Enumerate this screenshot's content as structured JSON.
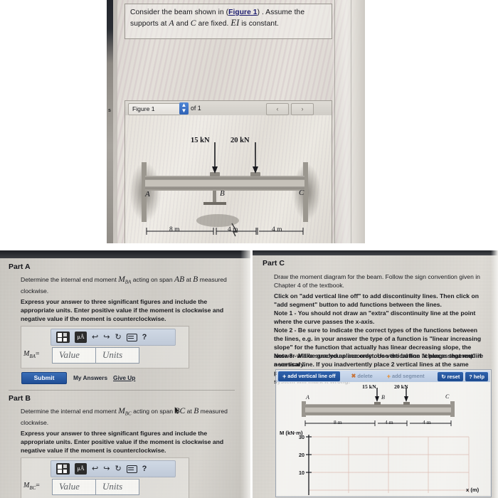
{
  "problem": {
    "statement_pre": "Consider the beam shown in (",
    "figure_link": "Figure 1",
    "statement_mid": ") . Assume the supports at ",
    "var_a": "A",
    "statement_and": " and ",
    "var_c": "C",
    "statement_fixed": " are fixed. ",
    "var_ei": "EI",
    "statement_post": " is constant."
  },
  "figure_panel": {
    "selector_value": "Figure 1",
    "of_label": "of 1",
    "prev_icon": "chevron-left",
    "next_icon": "chevron-right",
    "spinner_icon": "up-down-arrows"
  },
  "beam_figure": {
    "load_1": "15 kN",
    "load_2": "20 kN",
    "point_a": "A",
    "point_b": "B",
    "point_c": "C",
    "dim_1": "8 m",
    "dim_2": "4 m",
    "dim_3": "4 m"
  },
  "part_a": {
    "heading": "Part A",
    "prompt_pre": "Determine the internal end moment ",
    "prompt_symbol": "M",
    "prompt_sub": "BA",
    "prompt_mid": " acting on span ",
    "span": "AB",
    "prompt_at": " at ",
    "at_point": "B",
    "prompt_post": " measured clockwise.",
    "instruction": "Express your answer to three significant figures and include the appropriate units. Enter positive value if the moment is clockwise and negative value if the moment is counterclockwise.",
    "answer_label": "M",
    "answer_label_sub": "BA",
    "answer_equals": "=",
    "value_placeholder": "Value",
    "units_placeholder": "Units",
    "submit_label": "Submit",
    "my_answers_label": "My Answers",
    "give_up_label": "Give Up",
    "toolbar_icons": [
      "template-icon",
      "units-icon",
      "undo-icon",
      "redo-icon",
      "reset-icon",
      "keyboard-icon",
      "help-icon"
    ],
    "units_btn_label": "μÅ",
    "help_label": "?"
  },
  "part_b": {
    "heading": "Part B",
    "prompt_pre": "Determine the internal end moment ",
    "prompt_symbol": "M",
    "prompt_sub": "BC",
    "prompt_mid": " acting on span ",
    "span": "BC",
    "prompt_at": " at ",
    "at_point": "B",
    "prompt_post": " measured clockwise.",
    "instruction": "Express your answer to three significant figures and include the appropriate units. Enter positive value if the moment is clockwise and negative value if the moment is counterclockwise.",
    "answer_label": "M",
    "answer_label_sub": "BC",
    "answer_equals": "=",
    "value_placeholder": "Value",
    "units_placeholder": "Units",
    "units_btn_label": "μÅ",
    "help_label": "?"
  },
  "part_c": {
    "heading": "Part C",
    "prompt": "Draw the moment diagram for the beam. Follow the sign convention given in Chapter 4 of the textbook.",
    "note_intro": "Click on \"add vertical line off\" to add discontinuity lines. Then click on \"add segment\" button to add functions between the lines.",
    "note_1": "Note 1 - You should not draw an \"extra\" discontinuity line at the point where the curve passes the x-axis.",
    "note_2": "Note 2 - Be sure to indicate the correct types of the functions between the lines, e.g. in your answer the type of a function is \"linear increasing slope\" for the function that actually has linear decreasing slope, the answer will be graded as incorrect. Use the button \"change segment\" if necessary.",
    "note_3": "Note 3 - Make sure you place only one vertical line at places that require a vertical line. If you inadvertently place 2 vertical lines at the same place, it will appear correct visually because the lines overlap, but the system will mark it wrong.",
    "toolbar": {
      "add_vertical_line": "add vertical line off",
      "delete": "delete",
      "add_segment": "add segment",
      "reset": "reset",
      "help": "help"
    },
    "beam": {
      "load_1": "15 kN",
      "load_2": "20 kN",
      "point_a": "A",
      "point_b": "B",
      "point_c": "C",
      "dim_1": "8 m",
      "dim_2": "4 m",
      "dim_3": "4 m"
    }
  },
  "chart_data": {
    "type": "line",
    "title": "",
    "xlabel": "x (m)",
    "ylabel": "M (kN·m)",
    "ytick_labels": [
      "30",
      "20",
      "10"
    ],
    "ytick_values": [
      30,
      20,
      10
    ],
    "ylim": [
      0,
      32
    ],
    "xlim": [
      0,
      16
    ],
    "grid": true,
    "series": [],
    "note": "empty answer grid - no curve drawn yet"
  }
}
